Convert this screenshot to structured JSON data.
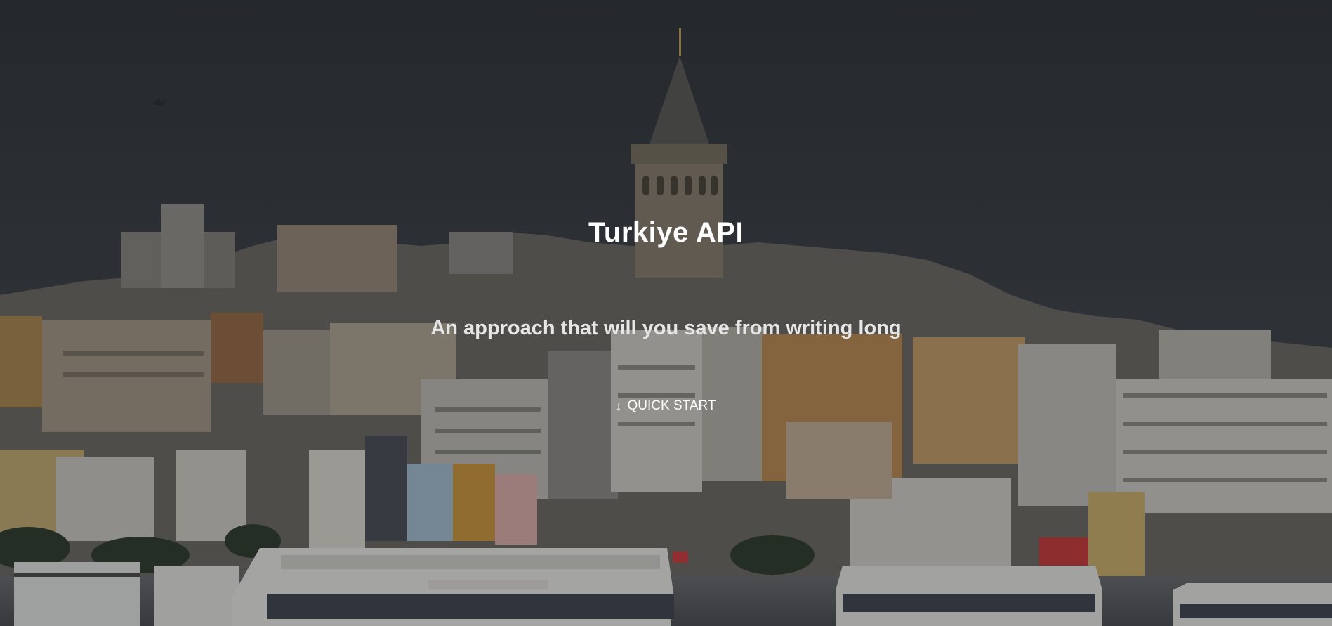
{
  "hero": {
    "title": "Turkiye API",
    "subtitle": "An approach that will you save from writing long",
    "cta_icon": "arrow-down-icon",
    "cta_label": "QUICK START",
    "background_image": "istanbul-galata-tower-skyline-photo"
  },
  "colors": {
    "text_primary": "#ffffff",
    "text_secondary": "#e6e6e6",
    "overlay": "#14161a"
  }
}
